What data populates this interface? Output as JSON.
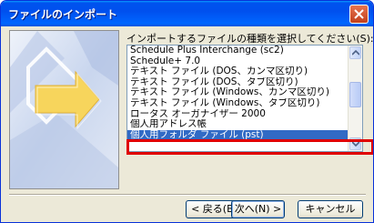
{
  "window": {
    "title": "ファイルのインポート"
  },
  "instruction": "インポートするファイルの種類を選択してください(S):",
  "file_types": [
    "Schedule Plus Interchange (sc2)",
    "Schedule+ 7.0",
    "テキスト ファイル (DOS、カンマ区切り)",
    "テキスト ファイル (DOS、タブ区切り)",
    "テキスト ファイル (Windows、カンマ区切り)",
    "テキスト ファイル (Windows、タブ区切り)",
    "ロータス オーガナイザー 2000",
    "個人用アドレス帳",
    "個人用フォルダ ファイル (pst)"
  ],
  "selected_index": 8,
  "buttons": {
    "back": "< 戻る(B)",
    "next": "次へ(N) >",
    "cancel": "キャンセル"
  },
  "colors": {
    "titlebar": "#0054e3",
    "selection": "#316ac5",
    "highlight_frame": "#e00000"
  },
  "icons": {
    "close": "close-icon",
    "scroll_up": "scroll-up-arrow-icon",
    "scroll_down": "scroll-down-arrow-icon",
    "wizard_art": "wizard-arrow-graphic"
  }
}
